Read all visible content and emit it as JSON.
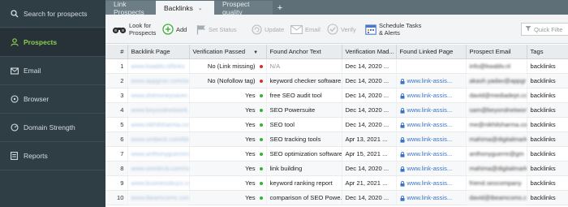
{
  "sidebar": {
    "search_label": "Search for prospects",
    "items": [
      {
        "label": "Prospects",
        "icon": "user-icon"
      },
      {
        "label": "Email",
        "icon": "envelope-icon"
      },
      {
        "label": "Browser",
        "icon": "browser-icon"
      },
      {
        "label": "Domain Strength",
        "icon": "gauge-icon"
      },
      {
        "label": "Reports",
        "icon": "report-icon"
      }
    ]
  },
  "tabs": [
    {
      "label": "Link Prospects"
    },
    {
      "label": "Backlinks"
    },
    {
      "label": "Prospect quality"
    }
  ],
  "toolbar": {
    "look_for_prospects": "Look for\nProspects",
    "add": "Add",
    "set_status": "Set Status",
    "update": "Update",
    "email": "Email",
    "verify": "Verify",
    "schedule": "Schedule Tasks\n& Alerts",
    "quick_filter_placeholder": "Quick Filte"
  },
  "table": {
    "headers": [
      "#",
      "Backlink Page",
      "Verification Passed",
      "Found Anchor Text",
      "Verification Mad...",
      "Found Linked Page",
      "Prospect Email",
      "Tags"
    ],
    "rows": [
      {
        "n": "1",
        "page": "www.kwablv.nl/links",
        "vp": "No (Link missing)",
        "status": "red",
        "anchor": "N/A",
        "anchor_muted": true,
        "date": "Dec 14, 2020 ...",
        "linked": "",
        "email": "info@kwablv.nl",
        "tags": "backlinks"
      },
      {
        "n": "2",
        "page": "www.appgroo.com/seo",
        "vp": "No (Nofollow tag)",
        "status": "red",
        "anchor": "keyword checker software",
        "anchor_muted": false,
        "date": "Dec 14, 2020 ...",
        "linked": "www.link-assis...",
        "email": "akash.yadav@appgr",
        "tags": "backlinks"
      },
      {
        "n": "3",
        "page": "www.dstmoneysaver.com",
        "vp": "Yes",
        "status": "green",
        "anchor": "free SEO audit tool",
        "anchor_muted": false,
        "date": "Dec 14, 2020 ...",
        "linked": "www.link-assis...",
        "email": "david@mediadept.co",
        "tags": "backlinks"
      },
      {
        "n": "4",
        "page": "www.beyondnetwork.com",
        "vp": "Yes",
        "status": "green",
        "anchor": "SEO Powersuite",
        "anchor_muted": false,
        "date": "Dec 14, 2020 ...",
        "linked": "www.link-assis...",
        "email": "sam@beyondnetwork",
        "tags": "backlinks"
      },
      {
        "n": "5",
        "page": "www.nikhilsharma.com",
        "vp": "Yes",
        "status": "green",
        "anchor": "SEO tool",
        "anchor_muted": false,
        "date": "Dec 14, 2020 ...",
        "linked": "www.link-assis...",
        "email": "me@nikhilsharma.com",
        "tags": "backlinks"
      },
      {
        "n": "6",
        "page": "www.umbeck.com/blog",
        "vp": "Yes",
        "status": "green",
        "anchor": "SEO tracking tools",
        "anchor_muted": false,
        "date": "Apr 13, 2021 ...",
        "linked": "www.link-assis...",
        "email": "mahima@digitalmark",
        "tags": "backlinks"
      },
      {
        "n": "7",
        "page": "www.anthonyguerrero.com",
        "vp": "Yes",
        "status": "green",
        "anchor": "SEO optimization software",
        "anchor_muted": false,
        "date": "Apr 15, 2021 ...",
        "linked": "www.link-assis...",
        "email": "anthonyguerre@gm",
        "tags": "backlinks"
      },
      {
        "n": "8",
        "page": "www.omnitrcb.com/seo",
        "vp": "Yes",
        "status": "green",
        "anchor": "link building",
        "anchor_muted": false,
        "date": "Dec 14, 2020 ...",
        "linked": "www.link-assis...",
        "email": "mahima@digitalmark",
        "tags": "backlinks"
      },
      {
        "n": "9",
        "page": "www.businessbuzz.com",
        "vp": "Yes",
        "status": "green",
        "anchor": "keyword ranking report",
        "anchor_muted": false,
        "date": "Apr 21, 2021 ...",
        "linked": "www.link-assis...",
        "email": "friend.seocompany",
        "tags": "backlinks"
      },
      {
        "n": "10",
        "page": "www.ibeamcoms.com/seo",
        "vp": "Yes",
        "status": "green",
        "anchor": "comparison of SEO Powe...",
        "anchor_muted": false,
        "date": "Dec 14, 2020 ...",
        "linked": "www.link-assis...",
        "email": "david@ibeamcoms.c",
        "tags": "backlinks"
      }
    ]
  },
  "colors": {
    "sidebar_bg": "#2f3d45",
    "active_green": "#8ccc4e",
    "status_red": "#d0332a",
    "status_green": "#3cae3b",
    "link_blue": "#3a74c9"
  }
}
